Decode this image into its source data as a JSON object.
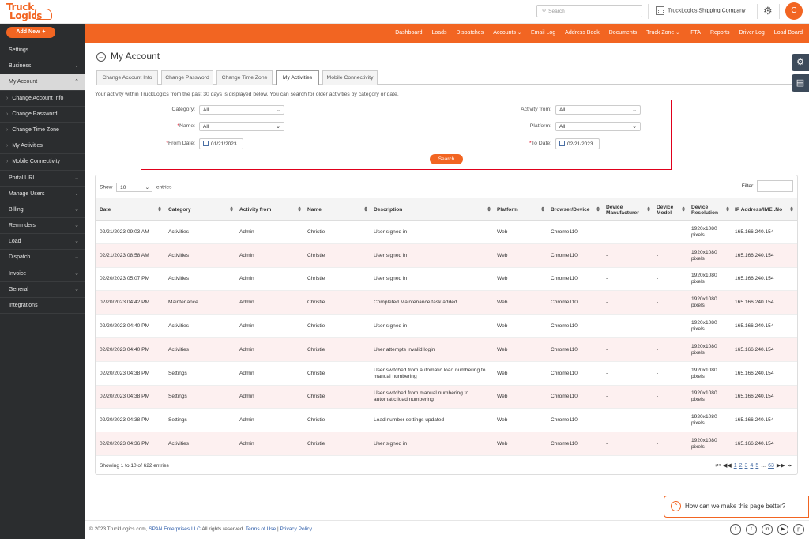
{
  "brand": {
    "logo_line1": "Truck",
    "logo_line2": "Logics"
  },
  "header": {
    "search_placeholder": "Search",
    "company": "TruckLogics Shipping Company",
    "avatar_initial": "C"
  },
  "sidebar": {
    "add_new": "Add New",
    "items": [
      {
        "label": "Settings",
        "chevron": false
      },
      {
        "label": "Business",
        "chevron": true
      },
      {
        "label": "My Account",
        "chevron": true,
        "active": true
      },
      {
        "label": "Change Account Info",
        "sub": true
      },
      {
        "label": "Change Password",
        "sub": true
      },
      {
        "label": "Change Time Zone",
        "sub": true
      },
      {
        "label": "My Activities",
        "sub": true
      },
      {
        "label": "Mobile Connectivity",
        "sub": true
      },
      {
        "label": "Portal URL",
        "chevron": true
      },
      {
        "label": "Manage Users",
        "chevron": true
      },
      {
        "label": "Billing",
        "chevron": true
      },
      {
        "label": "Reminders",
        "chevron": true
      },
      {
        "label": "Load",
        "chevron": true
      },
      {
        "label": "Dispatch",
        "chevron": true
      },
      {
        "label": "Invoice",
        "chevron": true
      },
      {
        "label": "General",
        "chevron": true
      },
      {
        "label": "Integrations",
        "chevron": false
      }
    ]
  },
  "topnav": {
    "items": [
      {
        "label": "Dashboard",
        "dropdown": false
      },
      {
        "label": "Loads",
        "dropdown": false
      },
      {
        "label": "Dispatches",
        "dropdown": false
      },
      {
        "label": "Accounts",
        "dropdown": true
      },
      {
        "label": "Email Log",
        "dropdown": false
      },
      {
        "label": "Address Book",
        "dropdown": false
      },
      {
        "label": "Documents",
        "dropdown": false
      },
      {
        "label": "Truck Zone",
        "dropdown": true
      },
      {
        "label": "IFTA",
        "dropdown": false
      },
      {
        "label": "Reports",
        "dropdown": false
      },
      {
        "label": "Driver Log",
        "dropdown": false
      },
      {
        "label": "Load Board",
        "dropdown": false
      }
    ]
  },
  "page": {
    "title": "My Account",
    "tabs": [
      "Change Account Info",
      "Change Password",
      "Change Time Zone",
      "My Activities",
      "Mobile Connectivity"
    ],
    "active_tab": "My Activities",
    "intro": "Your activity within TruckLogics from the past 30 days is displayed below. You can search for older activities by category or date."
  },
  "filters": {
    "category_label": "Category:",
    "category_value": "All",
    "name_label": "*Name:",
    "name_value": "All",
    "from_date_label": "*From Date:",
    "from_date_value": "01/21/2023",
    "activity_from_label": "Activity from:",
    "activity_from_value": "All",
    "platform_label": "Platform:",
    "platform_value": "All",
    "to_date_label": "*To Date:",
    "to_date_value": "02/21/2023",
    "search_button": "Search"
  },
  "table": {
    "show_label": "Show",
    "page_size": "10",
    "entries_label": "entries",
    "filter_label": "Filter:",
    "columns": [
      "Date",
      "Category",
      "Activity from",
      "Name",
      "Description",
      "Platform",
      "Browser/Device",
      "Device Manufacturer",
      "Device Model",
      "Device Resolution",
      "IP Address/IMEI.No"
    ],
    "rows": [
      [
        "02/21/2023 09:03 AM",
        "Activities",
        "Admin",
        "Christie",
        "User signed in",
        "Web",
        "Chrome110",
        "-",
        "-",
        "1920x1080 pixels",
        "165.166.240.154"
      ],
      [
        "02/21/2023 08:58 AM",
        "Activities",
        "Admin",
        "Christie",
        "User signed in",
        "Web",
        "Chrome110",
        "-",
        "-",
        "1920x1080 pixels",
        "165.166.240.154"
      ],
      [
        "02/20/2023 05:07 PM",
        "Activities",
        "Admin",
        "Christie",
        "User signed in",
        "Web",
        "Chrome110",
        "-",
        "-",
        "1920x1080 pixels",
        "165.166.240.154"
      ],
      [
        "02/20/2023 04:42 PM",
        "Maintenance",
        "Admin",
        "Christie",
        "Completed Maintenance task added",
        "Web",
        "Chrome110",
        "-",
        "-",
        "1920x1080 pixels",
        "165.166.240.154"
      ],
      [
        "02/20/2023 04:40 PM",
        "Activities",
        "Admin",
        "Christie",
        "User signed in",
        "Web",
        "Chrome110",
        "-",
        "-",
        "1920x1080 pixels",
        "165.166.240.154"
      ],
      [
        "02/20/2023 04:40 PM",
        "Activities",
        "Admin",
        "Christie",
        "User attempts invalid login",
        "Web",
        "Chrome110",
        "-",
        "-",
        "1920x1080 pixels",
        "165.166.240.154"
      ],
      [
        "02/20/2023 04:38 PM",
        "Settings",
        "Admin",
        "Christie",
        "User switched from automatic load numbering to manual numbering",
        "Web",
        "Chrome110",
        "-",
        "-",
        "1920x1080 pixels",
        "165.166.240.154"
      ],
      [
        "02/20/2023 04:38 PM",
        "Settings",
        "Admin",
        "Christie",
        "User switched from manual numbering to automatic load numbering",
        "Web",
        "Chrome110",
        "-",
        "-",
        "1920x1080 pixels",
        "165.166.240.154"
      ],
      [
        "02/20/2023 04:38 PM",
        "Settings",
        "Admin",
        "Christie",
        "Load number settings updated",
        "Web",
        "Chrome110",
        "-",
        "-",
        "1920x1080 pixels",
        "165.166.240.154"
      ],
      [
        "02/20/2023 04:36 PM",
        "Activities",
        "Admin",
        "Christie",
        "User signed in",
        "Web",
        "Chrome110",
        "-",
        "-",
        "1920x1080 pixels",
        "165.166.240.154"
      ]
    ],
    "info": "Showing 1 to 10 of 622 entries",
    "pager": [
      "1",
      "2",
      "3",
      "4",
      "5",
      "...",
      "63"
    ]
  },
  "feedback": {
    "label": "How can we make this page better?"
  },
  "footer": {
    "copyright": "© 2023 TruckLogics.com,",
    "company_link": "SPAN Enterprises LLC",
    "rights": "All rights reserved.",
    "terms": "Terms of Use",
    "sep": "|",
    "privacy": "Privacy Policy"
  },
  "colors": {
    "accent": "#f26522",
    "sidebar": "#2b2d2f",
    "highlight_border": "#e0001b"
  }
}
